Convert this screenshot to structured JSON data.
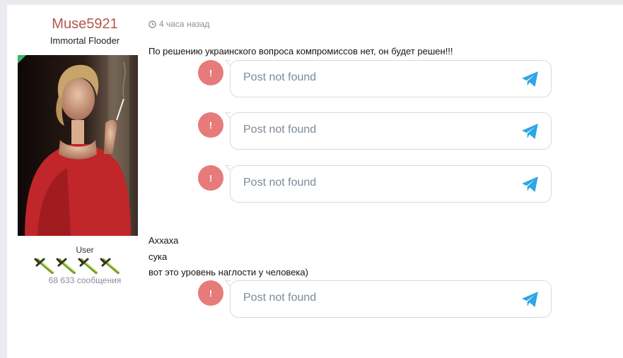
{
  "author": {
    "username": "Muse5921",
    "title": "Immortal Flooder",
    "role": "User",
    "messages": "68 633 сообщения",
    "rank_icon": "sword-icon",
    "rank_icon_count": 4
  },
  "post": {
    "time": "4 часа назад",
    "text1": "По решению украинского вопроса компромиссов нет, он будет решен!!!",
    "text2": [
      "Аххаха",
      "сука",
      "вот это уровень наглости у человека)"
    ]
  },
  "embed": {
    "alert_symbol": "!",
    "text": "Post not found",
    "icon": "telegram-icon"
  },
  "colors": {
    "username": "#b5574c",
    "alert": "#e77a7a",
    "telegram": "#2ea6e6",
    "online": "#3cb371"
  }
}
